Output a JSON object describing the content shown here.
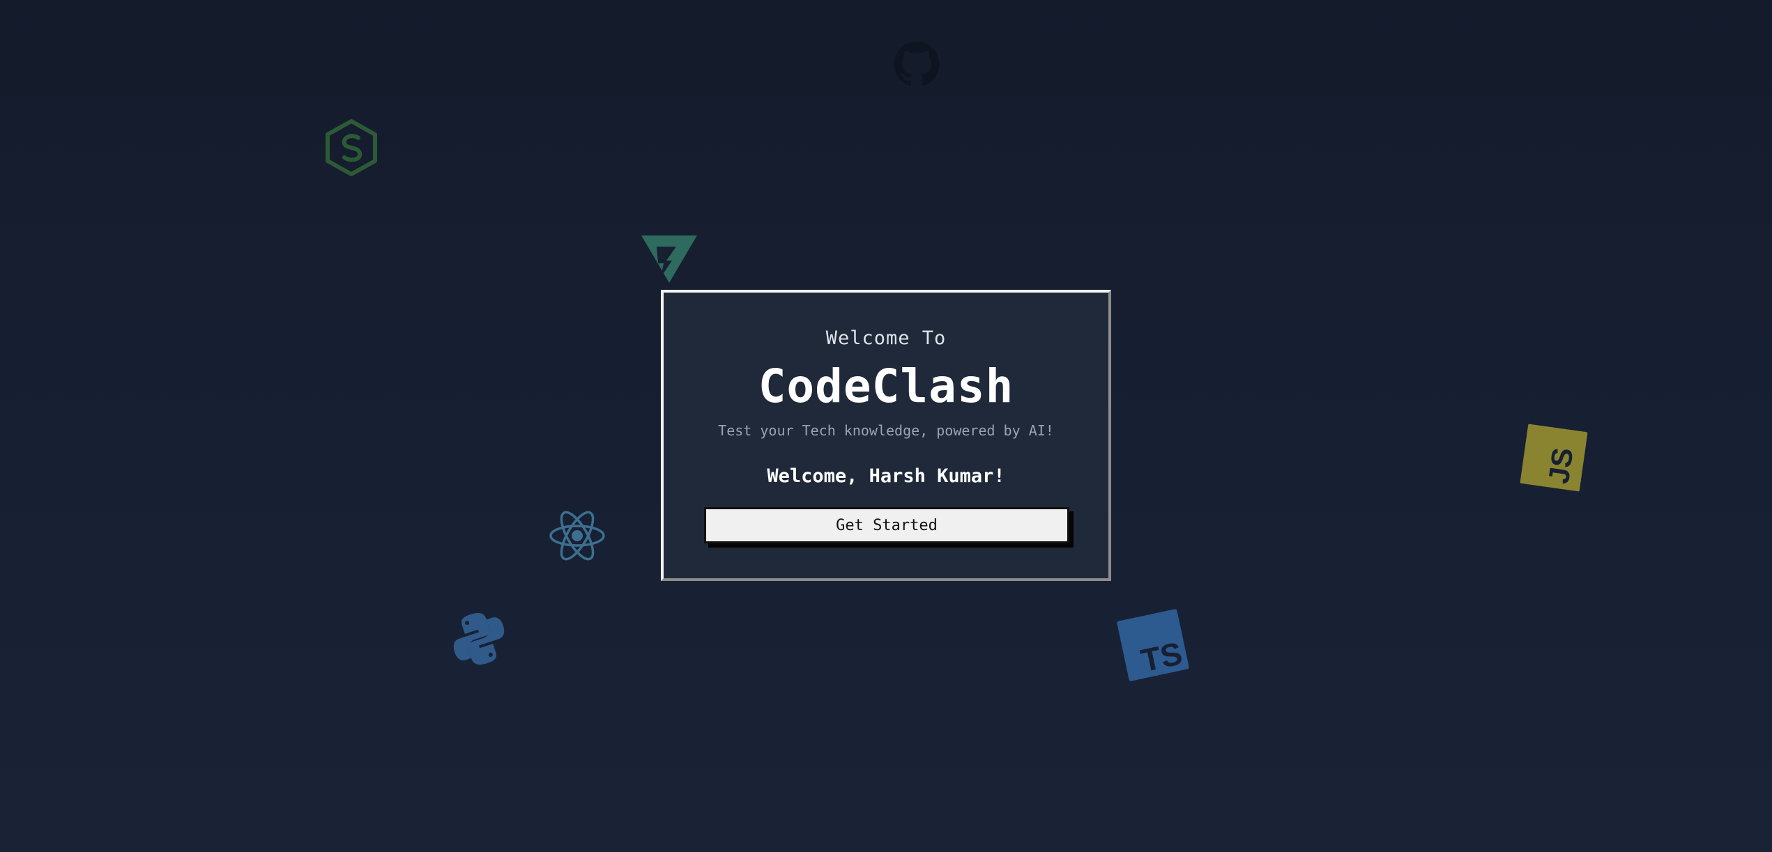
{
  "card": {
    "welcome_to": "Welcome To",
    "title": "CodeClash",
    "tagline": "Test your Tech knowledge, powered by AI!",
    "greeting": "Welcome, Harsh Kumar!",
    "cta_label": "Get Started"
  },
  "decor": {
    "icons": [
      "github-icon",
      "nodejs-icon",
      "vitest-icon",
      "react-icon",
      "python-icon",
      "typescript-icon",
      "javascript-icon"
    ],
    "typescript_label": "TS",
    "javascript_label": "JS"
  },
  "colors": {
    "background": "#161e2f",
    "card": "#1f2939",
    "button": "#f0f0f0",
    "nodejs": "#2d5a36",
    "vitest": "#2e6a5e",
    "react": "#3d6f8f",
    "python": "#2f5a8a",
    "typescript": "#2d5a8f",
    "javascript": "#8a8431"
  }
}
